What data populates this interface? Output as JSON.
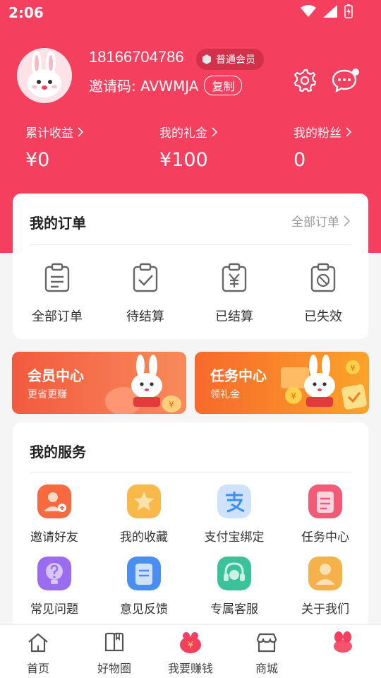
{
  "status": {
    "time": "2:06"
  },
  "profile": {
    "phone": "18166704786",
    "member_level": "普通会员",
    "invite_label": "邀请码: ",
    "invite_code": "AVWMJA",
    "copy_label": "复制"
  },
  "stats": [
    {
      "label": "累计收益",
      "value": "¥0"
    },
    {
      "label": "我的礼金",
      "value": "¥100"
    },
    {
      "label": "我的粉丝",
      "value": "0"
    }
  ],
  "orders": {
    "title": "我的订单",
    "all_link": "全部订单",
    "items": [
      {
        "label": "全部订单",
        "icon": "clipboard-list-icon"
      },
      {
        "label": "待结算",
        "icon": "clipboard-check-icon"
      },
      {
        "label": "已结算",
        "icon": "clipboard-yen-icon"
      },
      {
        "label": "已失效",
        "icon": "clipboard-ban-icon"
      }
    ]
  },
  "promos": [
    {
      "title": "会员中心",
      "subtitle": "更省更赚"
    },
    {
      "title": "任务中心",
      "subtitle": "领礼金"
    }
  ],
  "services": {
    "title": "我的服务",
    "items": [
      {
        "label": "邀请好友",
        "icon": "invite-friend-icon",
        "color": "#f7693e"
      },
      {
        "label": "我的收藏",
        "icon": "star-icon",
        "color": "#f8b84a"
      },
      {
        "label": "支付宝绑定",
        "icon": "alipay-icon",
        "color": "#3d8ef0"
      },
      {
        "label": "任务中心",
        "icon": "task-list-icon",
        "color": "#f25a78"
      },
      {
        "label": "常见问题",
        "icon": "question-bulb-icon",
        "color": "#9a6cf0"
      },
      {
        "label": "意见反馈",
        "icon": "feedback-doc-icon",
        "color": "#4a8ef0"
      },
      {
        "label": "专属客服",
        "icon": "headset-icon",
        "color": "#3cc29a"
      },
      {
        "label": "关于我们",
        "icon": "about-user-icon",
        "color": "#f5b24a"
      }
    ]
  },
  "tabs": [
    {
      "label": "首页"
    },
    {
      "label": "好物圈"
    },
    {
      "label": "我要赚钱"
    },
    {
      "label": "商城"
    },
    {
      "label": ""
    }
  ],
  "colors": {
    "brand": "#f43f5e",
    "accent_orange": "#f26a2e"
  }
}
